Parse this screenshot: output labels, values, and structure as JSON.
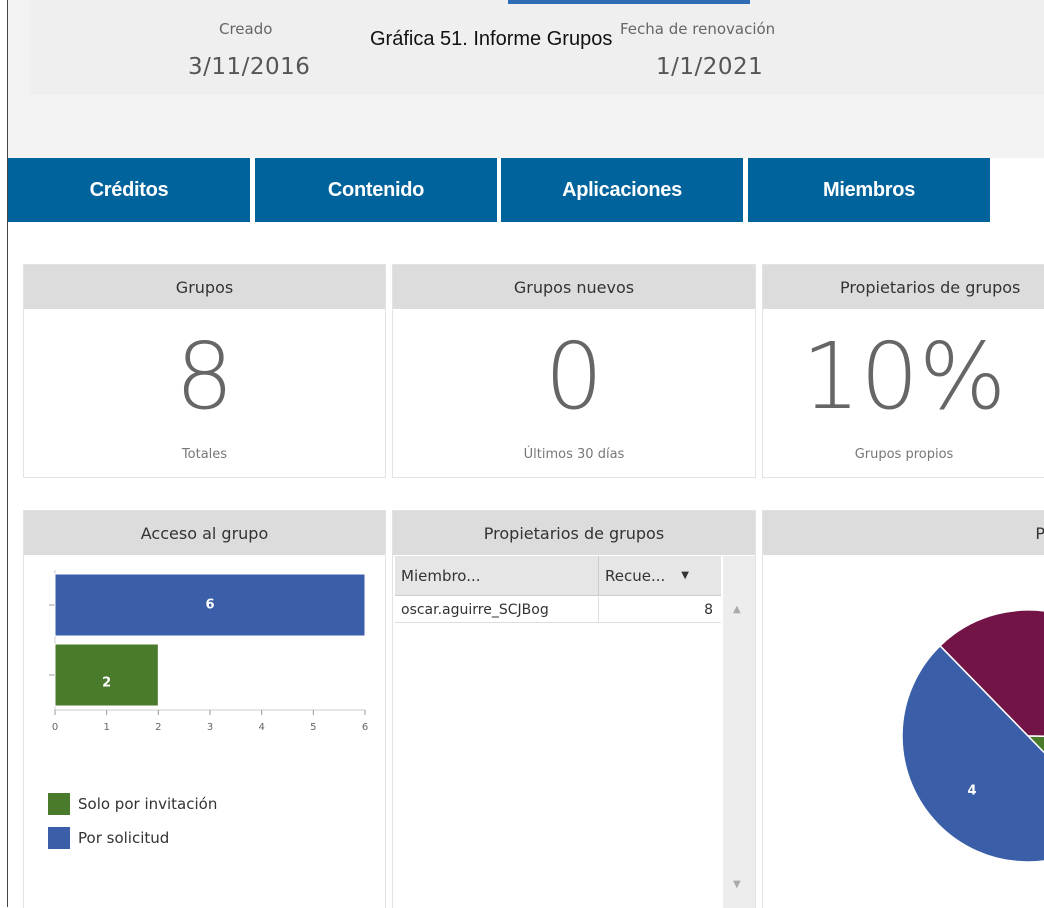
{
  "caption": "Gráfica 51. Informe Grupos",
  "header": {
    "created_label": "Creado",
    "created_value": "3/11/2016",
    "renewal_label": "Fecha de renovación",
    "renewal_value": "1/1/2021"
  },
  "tabs": [
    {
      "label": "Créditos"
    },
    {
      "label": "Contenido"
    },
    {
      "label": "Aplicaciones"
    },
    {
      "label": "Miembros"
    }
  ],
  "stats": [
    {
      "title": "Grupos",
      "value": "8",
      "sub": "Totales"
    },
    {
      "title": "Grupos nuevos",
      "value": "0",
      "sub": "Últimos 30 días"
    },
    {
      "title": "Propietarios de grupos",
      "value": "10%",
      "sub": "Grupos propios"
    }
  ],
  "access_card": {
    "title": "Acceso al grupo",
    "legend": [
      {
        "label": "Solo por invitación",
        "color": "#4a7a2c"
      },
      {
        "label": "Por solicitud",
        "color": "#3a5fa8"
      }
    ]
  },
  "owners_card": {
    "title": "Propietarios de grupos",
    "columns": [
      "Miembro...",
      "Recue..."
    ],
    "rows": [
      {
        "member": "oscar.aguirre_SCJBog",
        "count": "8"
      }
    ]
  },
  "pie_card": {
    "title": "P"
  },
  "chart_data": [
    {
      "type": "bar",
      "orientation": "horizontal",
      "categories": [
        "Por solicitud",
        "Solo por invitación"
      ],
      "values": [
        6,
        2
      ],
      "colors": [
        "#3a5fa8",
        "#4a7a2c"
      ],
      "xlim": [
        0,
        6
      ],
      "xticks": [
        "0",
        "1",
        "2",
        "3",
        "4",
        "5",
        "6"
      ],
      "data_labels": true
    },
    {
      "type": "pie",
      "slices": [
        {
          "value": 3,
          "color": "#731447"
        },
        {
          "value": 1,
          "color": "#4a7a2c"
        },
        {
          "value": 4,
          "color": "#3a5fa8"
        }
      ]
    }
  ]
}
